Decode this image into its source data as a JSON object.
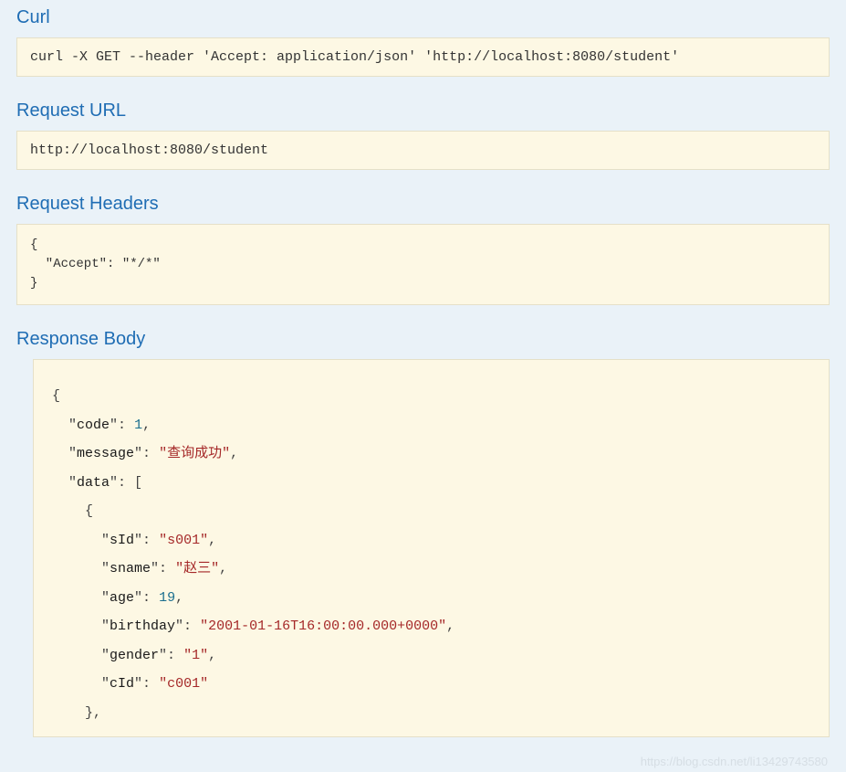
{
  "sections": {
    "curl": {
      "heading": "Curl",
      "content": "curl -X GET --header 'Accept: application/json' 'http://localhost:8080/student'"
    },
    "requestUrl": {
      "heading": "Request URL",
      "content": "http://localhost:8080/student"
    },
    "requestHeaders": {
      "heading": "Request Headers",
      "raw": "{\n  \"Accept\": \"*/*\"\n}",
      "object": {
        "Accept": "*/*"
      }
    },
    "responseBody": {
      "heading": "Response Body",
      "object": {
        "code": 1,
        "message": "查询成功",
        "data": [
          {
            "sId": "s001",
            "sname": "赵三",
            "age": 19,
            "birthday": "2001-01-16T16:00:00.000+0000",
            "gender": "1",
            "cId": "c001"
          }
        ]
      },
      "display": {
        "keys": {
          "code": "code",
          "message": "message",
          "data": "data",
          "sId": "sId",
          "sname": "sname",
          "age": "age",
          "birthday": "birthday",
          "gender": "gender",
          "cId": "cId"
        },
        "values": {
          "code": "1",
          "message": "查询成功",
          "sId": "s001",
          "sname": "赵三",
          "age": "19",
          "birthday": "2001-01-16T16:00:00.000+0000",
          "gender": "1",
          "cId": "c001"
        }
      }
    }
  },
  "watermark": "https://blog.csdn.net/li13429743580"
}
